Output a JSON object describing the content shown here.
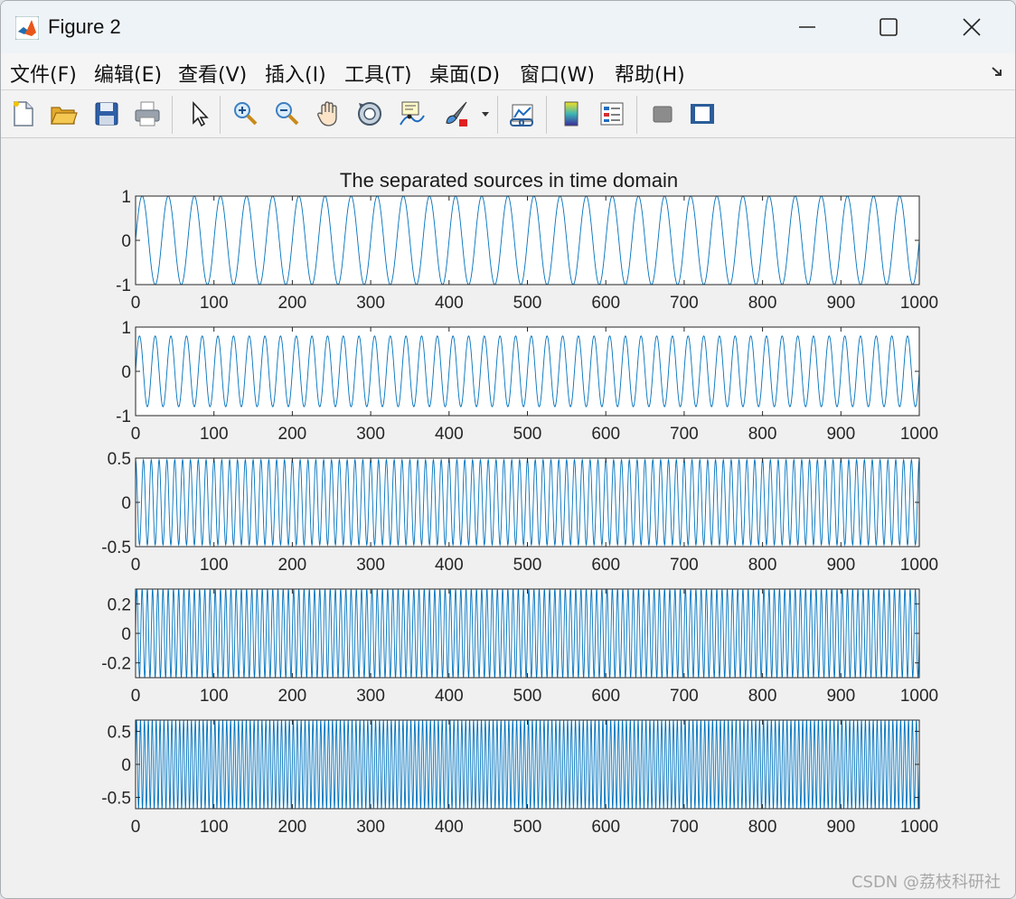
{
  "window": {
    "title": "Figure 2"
  },
  "menu": [
    {
      "label": "文件(F)"
    },
    {
      "label": "编辑(E)"
    },
    {
      "label": "查看(V)"
    },
    {
      "label": "插入(I)"
    },
    {
      "label": "工具(T)"
    },
    {
      "label": "桌面(D)"
    },
    {
      "label": "窗口(W)"
    },
    {
      "label": "帮助(H)"
    }
  ],
  "toolbar": [
    {
      "icon": "new-figure-icon"
    },
    {
      "icon": "open-file-icon"
    },
    {
      "icon": "save-icon"
    },
    {
      "icon": "print-icon"
    },
    {
      "icon": "select-pointer-icon"
    },
    {
      "icon": "zoom-in-icon"
    },
    {
      "icon": "zoom-out-icon"
    },
    {
      "icon": "pan-hand-icon"
    },
    {
      "icon": "rotate-3d-icon"
    },
    {
      "icon": "data-cursor-icon"
    },
    {
      "icon": "brush-icon"
    },
    {
      "icon": "link-plot-icon"
    },
    {
      "icon": "colorbar-icon"
    },
    {
      "icon": "legend-icon"
    },
    {
      "icon": "hide-plot-tools-icon"
    },
    {
      "icon": "show-plot-tools-icon"
    }
  ],
  "watermark": "CSDN @荔枝科研社",
  "colors": {
    "line": "#0072BD",
    "axes_bg": "#ffffff",
    "figure_bg": "#f0f0f0"
  },
  "chart_data": [
    {
      "type": "line",
      "title": "The separated sources in time domain",
      "xlim": [
        0,
        1000
      ],
      "xticks": [
        "0",
        "100",
        "200",
        "300",
        "400",
        "500",
        "600",
        "700",
        "800",
        "900",
        "1000"
      ],
      "ylim": [
        -1,
        1
      ],
      "yticks": [
        "1",
        "0",
        "-1"
      ],
      "series": [
        {
          "waveform": "sine",
          "amplitude": 1.0,
          "cycles": 30,
          "phase_deg": 0
        }
      ]
    },
    {
      "type": "line",
      "title": "",
      "xlim": [
        0,
        1000
      ],
      "xticks": [
        "0",
        "100",
        "200",
        "300",
        "400",
        "500",
        "600",
        "700",
        "800",
        "900",
        "1000"
      ],
      "ylim": [
        -1,
        1
      ],
      "yticks": [
        "1",
        "0",
        "-1"
      ],
      "series": [
        {
          "waveform": "sine",
          "amplitude": 0.8,
          "cycles": 50,
          "phase_deg": 0
        }
      ]
    },
    {
      "type": "line",
      "title": "",
      "xlim": [
        0,
        1000
      ],
      "xticks": [
        "0",
        "100",
        "200",
        "300",
        "400",
        "500",
        "600",
        "700",
        "800",
        "900",
        "1000"
      ],
      "ylim": [
        -0.5,
        0.5
      ],
      "yticks": [
        "0.5",
        "0",
        "-0.5"
      ],
      "series": [
        {
          "waveform": "sine",
          "amplitude": 0.48,
          "cycles": 100,
          "phase_deg": 90
        }
      ]
    },
    {
      "type": "line",
      "title": "",
      "xlim": [
        0,
        1000
      ],
      "xticks": [
        "0",
        "100",
        "200",
        "300",
        "400",
        "500",
        "600",
        "700",
        "800",
        "900",
        "1000"
      ],
      "ylim": [
        -0.3,
        0.3
      ],
      "yticks": [
        "0.2",
        "0",
        "-0.2"
      ],
      "series": [
        {
          "waveform": "sine",
          "amplitude": 0.3,
          "cycles": 150,
          "phase_deg": 0
        }
      ]
    },
    {
      "type": "line",
      "title": "",
      "xlim": [
        0,
        1000
      ],
      "xticks": [
        "0",
        "100",
        "200",
        "300",
        "400",
        "500",
        "600",
        "700",
        "800",
        "900",
        "1000"
      ],
      "ylim": [
        -0.67,
        0.67
      ],
      "yticks": [
        "0.5",
        "0",
        "-0.5"
      ],
      "series": [
        {
          "waveform": "sine",
          "amplitude": 0.67,
          "cycles": 200,
          "phase_deg": 0
        }
      ]
    }
  ]
}
